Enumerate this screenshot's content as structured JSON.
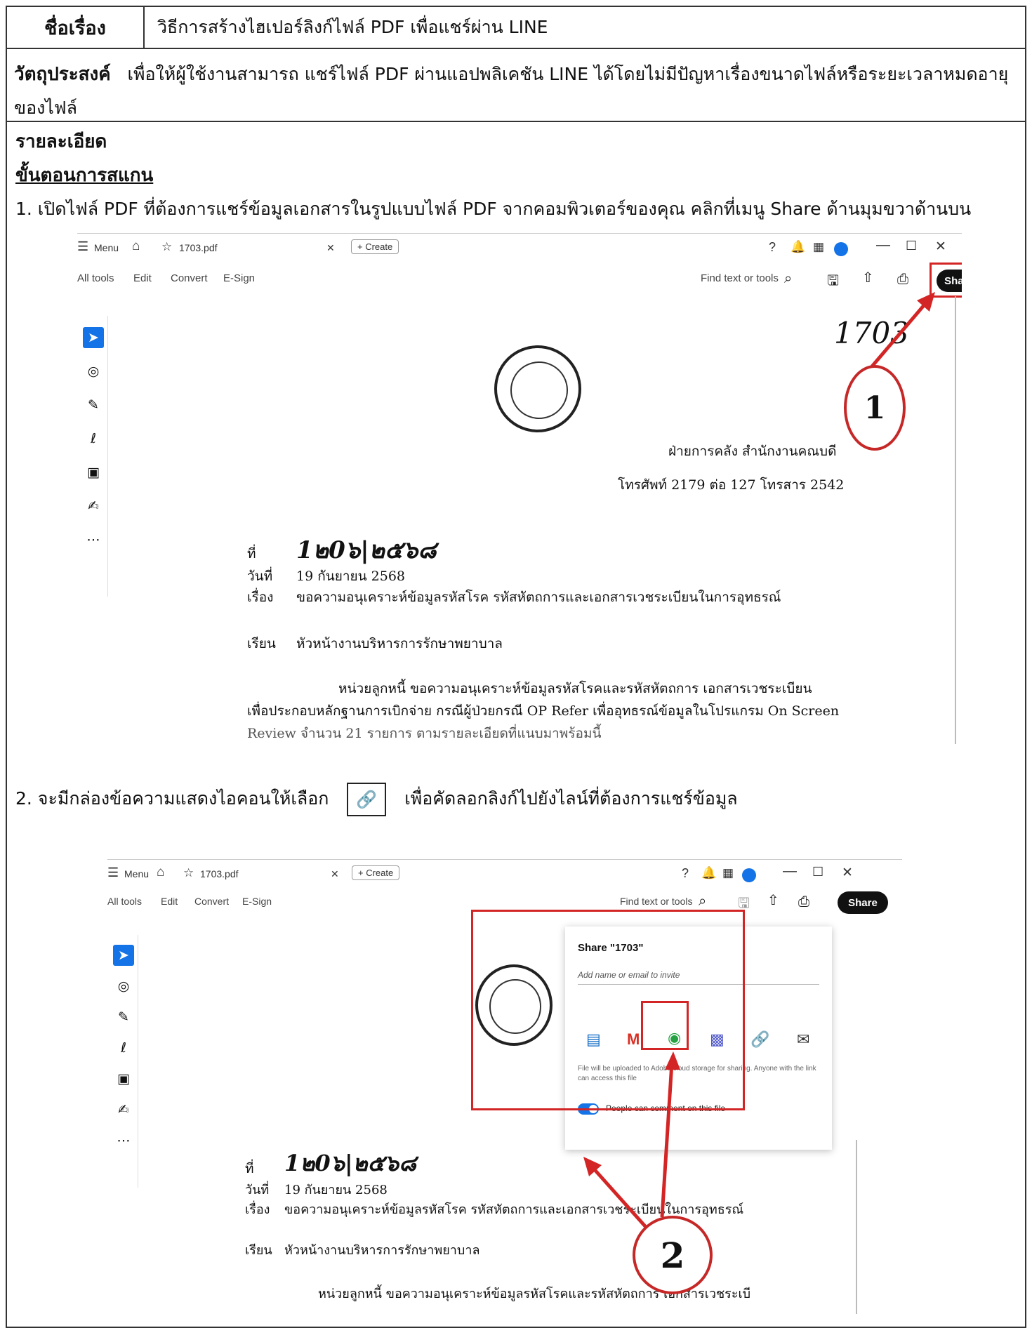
{
  "header": {
    "label": "ชื่อเรื่อง",
    "title": "วิธีการสร้างไฮเปอร์ลิงก์ไฟล์ PDF เพื่อแชร์ผ่าน LINE"
  },
  "objective": {
    "label": "วัตถุประสงค์",
    "text": "เพื่อให้ผู้ใช้งานสามารถ แชร์ไฟล์ PDF ผ่านแอปพลิเคชัน LINE ได้โดยไม่มีปัญหาเรื่องขนาดไฟล์หรือระยะเวลาหมดอายุของไฟล์"
  },
  "details": {
    "heading": "รายละเอียด",
    "subheading": "ขั้นตอนการสแกน",
    "step1": "1. เปิดไฟล์ PDF ที่ต้องการแชร์ข้อมูลเอกสารในรูปแบบไฟล์ PDF จากคอมพิวเตอร์ของคุณ คลิกที่เมนู Share ด้านมุมขวาด้านบน",
    "step2_before": "2. จะมีกล่องข้อความแสดงไอคอนให้เลือก",
    "step2_after": "เพื่อคัดลอกลิงก์ไปยังไลน์ที่ต้องการแชร์ข้อมูล"
  },
  "viewer": {
    "menu": "Menu",
    "filename": "1703.pdf",
    "create": "Create",
    "menu_items": [
      "All tools",
      "Edit",
      "Convert",
      "E-Sign"
    ],
    "find": "Find text or tools",
    "share": "Share",
    "window_min": "—",
    "window_max": "☐",
    "window_close": "✕"
  },
  "letter": {
    "handwritten_number": "1703",
    "dept": "ฝ่ายการคลัง สำนักงานคณบดี",
    "phone": "โทรศัพท์ 2179 ต่อ 127 โทรสาร 2542",
    "ref_label": "ที่",
    "ref_value": "1๒0๖|๒๕๖๘",
    "date_label": "วันที่",
    "date_value": "19 กันยายน 2568",
    "subject_label": "เรื่อง",
    "subject_value": "ขอความอนุเคราะห์ข้อมูลรหัสโรค รหัสหัตถการและเอกสารเวชระเบียนในการอุทธรณ์",
    "to_label": "เรียน",
    "to_value": "หัวหน้างานบริหารการรักษาพยาบาล",
    "body1": "หน่วยลูกหนี้ ขอความอนุเคราะห์ข้อมูลรหัสโรคและรหัสหัตถการ เอกสารเวชระเบียน",
    "body2": "เพื่อประกอบหลักฐานการเบิกจ่าย กรณีผู้ป่วยกรณี OP Refer เพื่ออุทธรณ์ข้อมูลในโปรแกรม On Screen",
    "body3": "Review จำนวน 21 รายการ ตามรายละเอียดที่แนบมาพร้อมนี้",
    "body1_short": "หน่วยลูกหนี้ ขอความอนุเคราะห์ข้อมูลรหัสโรคและรหัสหัตถการ เอกสารเวชระเบี"
  },
  "share_panel": {
    "title": "Share \"1703\"",
    "placeholder": "Add name or email to invite",
    "note": "File will be uploaded to Adobe cloud storage for sharing. Anyone with the link can access this file",
    "toggle_label": "People can comment on this file"
  },
  "callouts": [
    "1",
    "2"
  ],
  "colors": {
    "accent": "#d32525",
    "share_bg": "#111111",
    "toggle": "#1473e6"
  },
  "icons": [
    "hamburger-icon",
    "home-icon",
    "star-icon",
    "plus-icon",
    "help-icon",
    "bell-icon",
    "apps-icon",
    "avatar",
    "search-icon",
    "save-icon",
    "upload-icon",
    "print-icon",
    "select-icon",
    "comment-icon",
    "pen-icon",
    "draw-icon",
    "text-box-icon",
    "signature-icon",
    "more-icon",
    "outlook-icon",
    "gmail-icon",
    "whatsapp-icon",
    "teams-icon",
    "link-icon",
    "email-icon"
  ]
}
